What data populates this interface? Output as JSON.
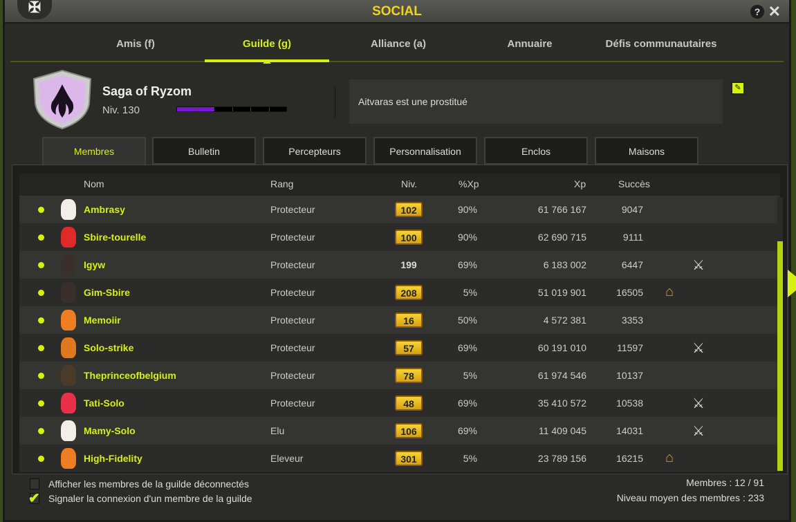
{
  "window": {
    "title": "SOCIAL"
  },
  "tabs": [
    {
      "label": "Amis (f)"
    },
    {
      "label": "Guilde (g)"
    },
    {
      "label": "Alliance (a)"
    },
    {
      "label": "Annuaire"
    },
    {
      "label": "Défis communautaires"
    }
  ],
  "guild": {
    "name": "Saga of Ryzom",
    "level": "Niv. 130",
    "xp_progress": 0.34,
    "message": "Aitvaras est une prostitué"
  },
  "subtabs": [
    {
      "label": "Membres"
    },
    {
      "label": "Bulletin"
    },
    {
      "label": "Percepteurs"
    },
    {
      "label": "Personnalisation"
    },
    {
      "label": "Enclos"
    },
    {
      "label": "Maisons"
    }
  ],
  "columns": {
    "nom": "Nom",
    "rang": "Rang",
    "niv": "Niv.",
    "pxp": "%Xp",
    "xp": "Xp",
    "succes": "Succès"
  },
  "members": [
    {
      "name": "Ambrasy",
      "rank": "Protecteur",
      "level": "102",
      "badge": true,
      "pxp": "90%",
      "xp": "61 766 167",
      "succes": "9047",
      "icon": ""
    },
    {
      "name": "Sbire-tourelle",
      "rank": "Protecteur",
      "level": "100",
      "badge": true,
      "pxp": "90%",
      "xp": "62 690 715",
      "succes": "9111",
      "icon": ""
    },
    {
      "name": "Igyw",
      "rank": "Protecteur",
      "level": "199",
      "badge": false,
      "pxp": "69%",
      "xp": "6 183 002",
      "succes": "6447",
      "icon": "crossed-swords"
    },
    {
      "name": "Gim-Sbire",
      "rank": "Protecteur",
      "level": "208",
      "badge": true,
      "pxp": "5%",
      "xp": "51 019 901",
      "succes": "16505",
      "icon": "house"
    },
    {
      "name": "Memoiir",
      "rank": "Protecteur",
      "level": "16",
      "badge": true,
      "pxp": "50%",
      "xp": "4 572 381",
      "succes": "3353",
      "icon": ""
    },
    {
      "name": "Solo-strike",
      "rank": "Protecteur",
      "level": "57",
      "badge": true,
      "pxp": "69%",
      "xp": "60 191 010",
      "succes": "11597",
      "icon": "crossed-swords"
    },
    {
      "name": "Theprinceofbelgium",
      "rank": "Protecteur",
      "level": "78",
      "badge": true,
      "pxp": "5%",
      "xp": "61 974 546",
      "succes": "10137",
      "icon": ""
    },
    {
      "name": "Tati-Solo",
      "rank": "Protecteur",
      "level": "48",
      "badge": true,
      "pxp": "69%",
      "xp": "35 410 572",
      "succes": "10538",
      "icon": "crossed-swords"
    },
    {
      "name": "Mamy-Solo",
      "rank": "Elu",
      "level": "106",
      "badge": true,
      "pxp": "69%",
      "xp": "11 409 045",
      "succes": "14031",
      "icon": "crossed-swords"
    },
    {
      "name": "High-Fidelity",
      "rank": "Eleveur",
      "level": "301",
      "badge": true,
      "pxp": "5%",
      "xp": "23 789 156",
      "succes": "16215",
      "icon": "house"
    }
  ],
  "footer": {
    "show_offline": "Afficher les membres de la guilde déconnectés",
    "show_offline_checked": false,
    "notify": "Signaler la connexion d'un membre de la guilde",
    "notify_checked": true,
    "members_count": "Membres : 12 / 91",
    "avg_level": "Niveau moyen des membres : 233"
  },
  "colors": {
    "accent": "#d7f014",
    "title": "#f2d21a",
    "xp_bar": "#7a16d8"
  }
}
